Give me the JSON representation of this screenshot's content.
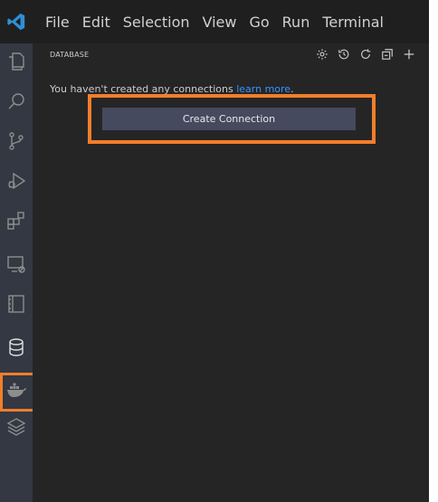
{
  "menu": [
    "File",
    "Edit",
    "Selection",
    "View",
    "Go",
    "Run",
    "Terminal"
  ],
  "activity_bar": [
    {
      "name": "explorer-icon"
    },
    {
      "name": "search-icon"
    },
    {
      "name": "source-control-icon"
    },
    {
      "name": "run-debug-icon"
    },
    {
      "name": "extensions-icon"
    },
    {
      "name": "remote-explorer-icon"
    },
    {
      "name": "notebook-icon"
    },
    {
      "name": "database-icon",
      "active": true
    },
    {
      "name": "docker-icon"
    },
    {
      "name": "layers-icon"
    }
  ],
  "sidebar": {
    "title": "DATABASE",
    "actions": [
      "settings-icon",
      "history-icon",
      "refresh-icon",
      "collapse-all-icon",
      "add-icon"
    ],
    "empty_message": "You haven't created any connections ",
    "learn_more": "learn more",
    "period": ".",
    "create_button": "Create Connection"
  },
  "colors": {
    "accent": "#f27e2a",
    "link": "#3794ff",
    "button": "#454a5f",
    "sidebar_bg": "#252526",
    "activity_bg": "#333842"
  }
}
